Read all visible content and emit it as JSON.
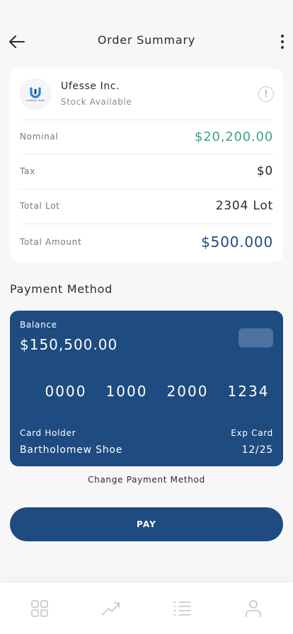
{
  "header": {
    "title": "Order Summary",
    "back_icon": "arrow-left-icon",
    "menu_icon": "more-vertical-icon"
  },
  "company": {
    "name": "Ufesse Inc.",
    "status": "Stock Available",
    "logo_text": "COMPANY NAME",
    "info_glyph": "!"
  },
  "summary": {
    "rows": [
      {
        "label": "Nominal",
        "value": "$20,200.00"
      },
      {
        "label": "Tax",
        "value": "$0"
      },
      {
        "label": "Total Lot",
        "value": "2304 Lot"
      },
      {
        "label": "Total Amount",
        "value": "$500.000"
      }
    ]
  },
  "payment": {
    "section_title": "Payment Method",
    "balance_label": "Balance",
    "balance_value": "$150,500.00",
    "card_number": [
      "0000",
      "1000",
      "2000",
      "1234"
    ],
    "holder_label": "Card Holder",
    "holder_name": "Bartholomew Shoe",
    "exp_label": "Exp Card",
    "exp_value": "12/25",
    "change_label": "Change Payment Method"
  },
  "pay_button": {
    "label": "PAY"
  },
  "nav": {
    "items": [
      "grid-icon",
      "trending-up-icon",
      "list-icon",
      "user-icon"
    ]
  },
  "colors": {
    "primary": "#1e4b80",
    "positive": "#3aa47e",
    "background": "#f7f7f7",
    "card": "#ffffff"
  }
}
